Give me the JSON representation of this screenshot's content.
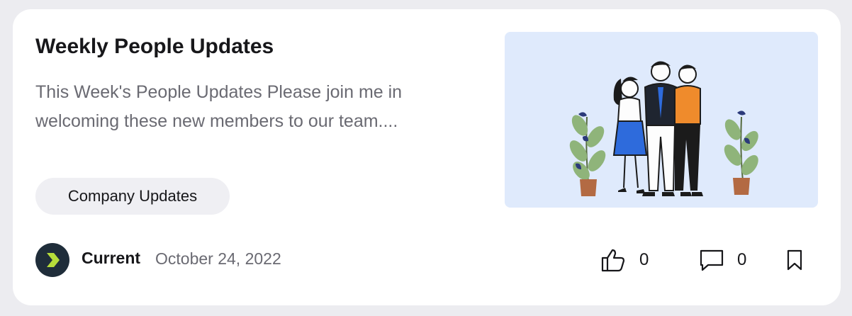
{
  "post": {
    "title": "Weekly People Updates",
    "excerpt": "This Week's People Updates Please join me in welcoming these new members to our team....",
    "tag": "Company Updates",
    "author": "Current",
    "date": "October 24, 2022",
    "likes": "0",
    "comments": "0"
  },
  "icons": {
    "avatar": "current-logo-icon",
    "like": "thumbs-up-icon",
    "comment": "comment-icon",
    "bookmark": "bookmark-icon"
  },
  "colors": {
    "card_bg": "#ffffff",
    "page_bg": "#ececf0",
    "image_bg": "#dfeafc",
    "tag_bg": "#efeff3",
    "avatar_bg": "#1f2d3a",
    "avatar_accent": "#b6dd3a"
  }
}
